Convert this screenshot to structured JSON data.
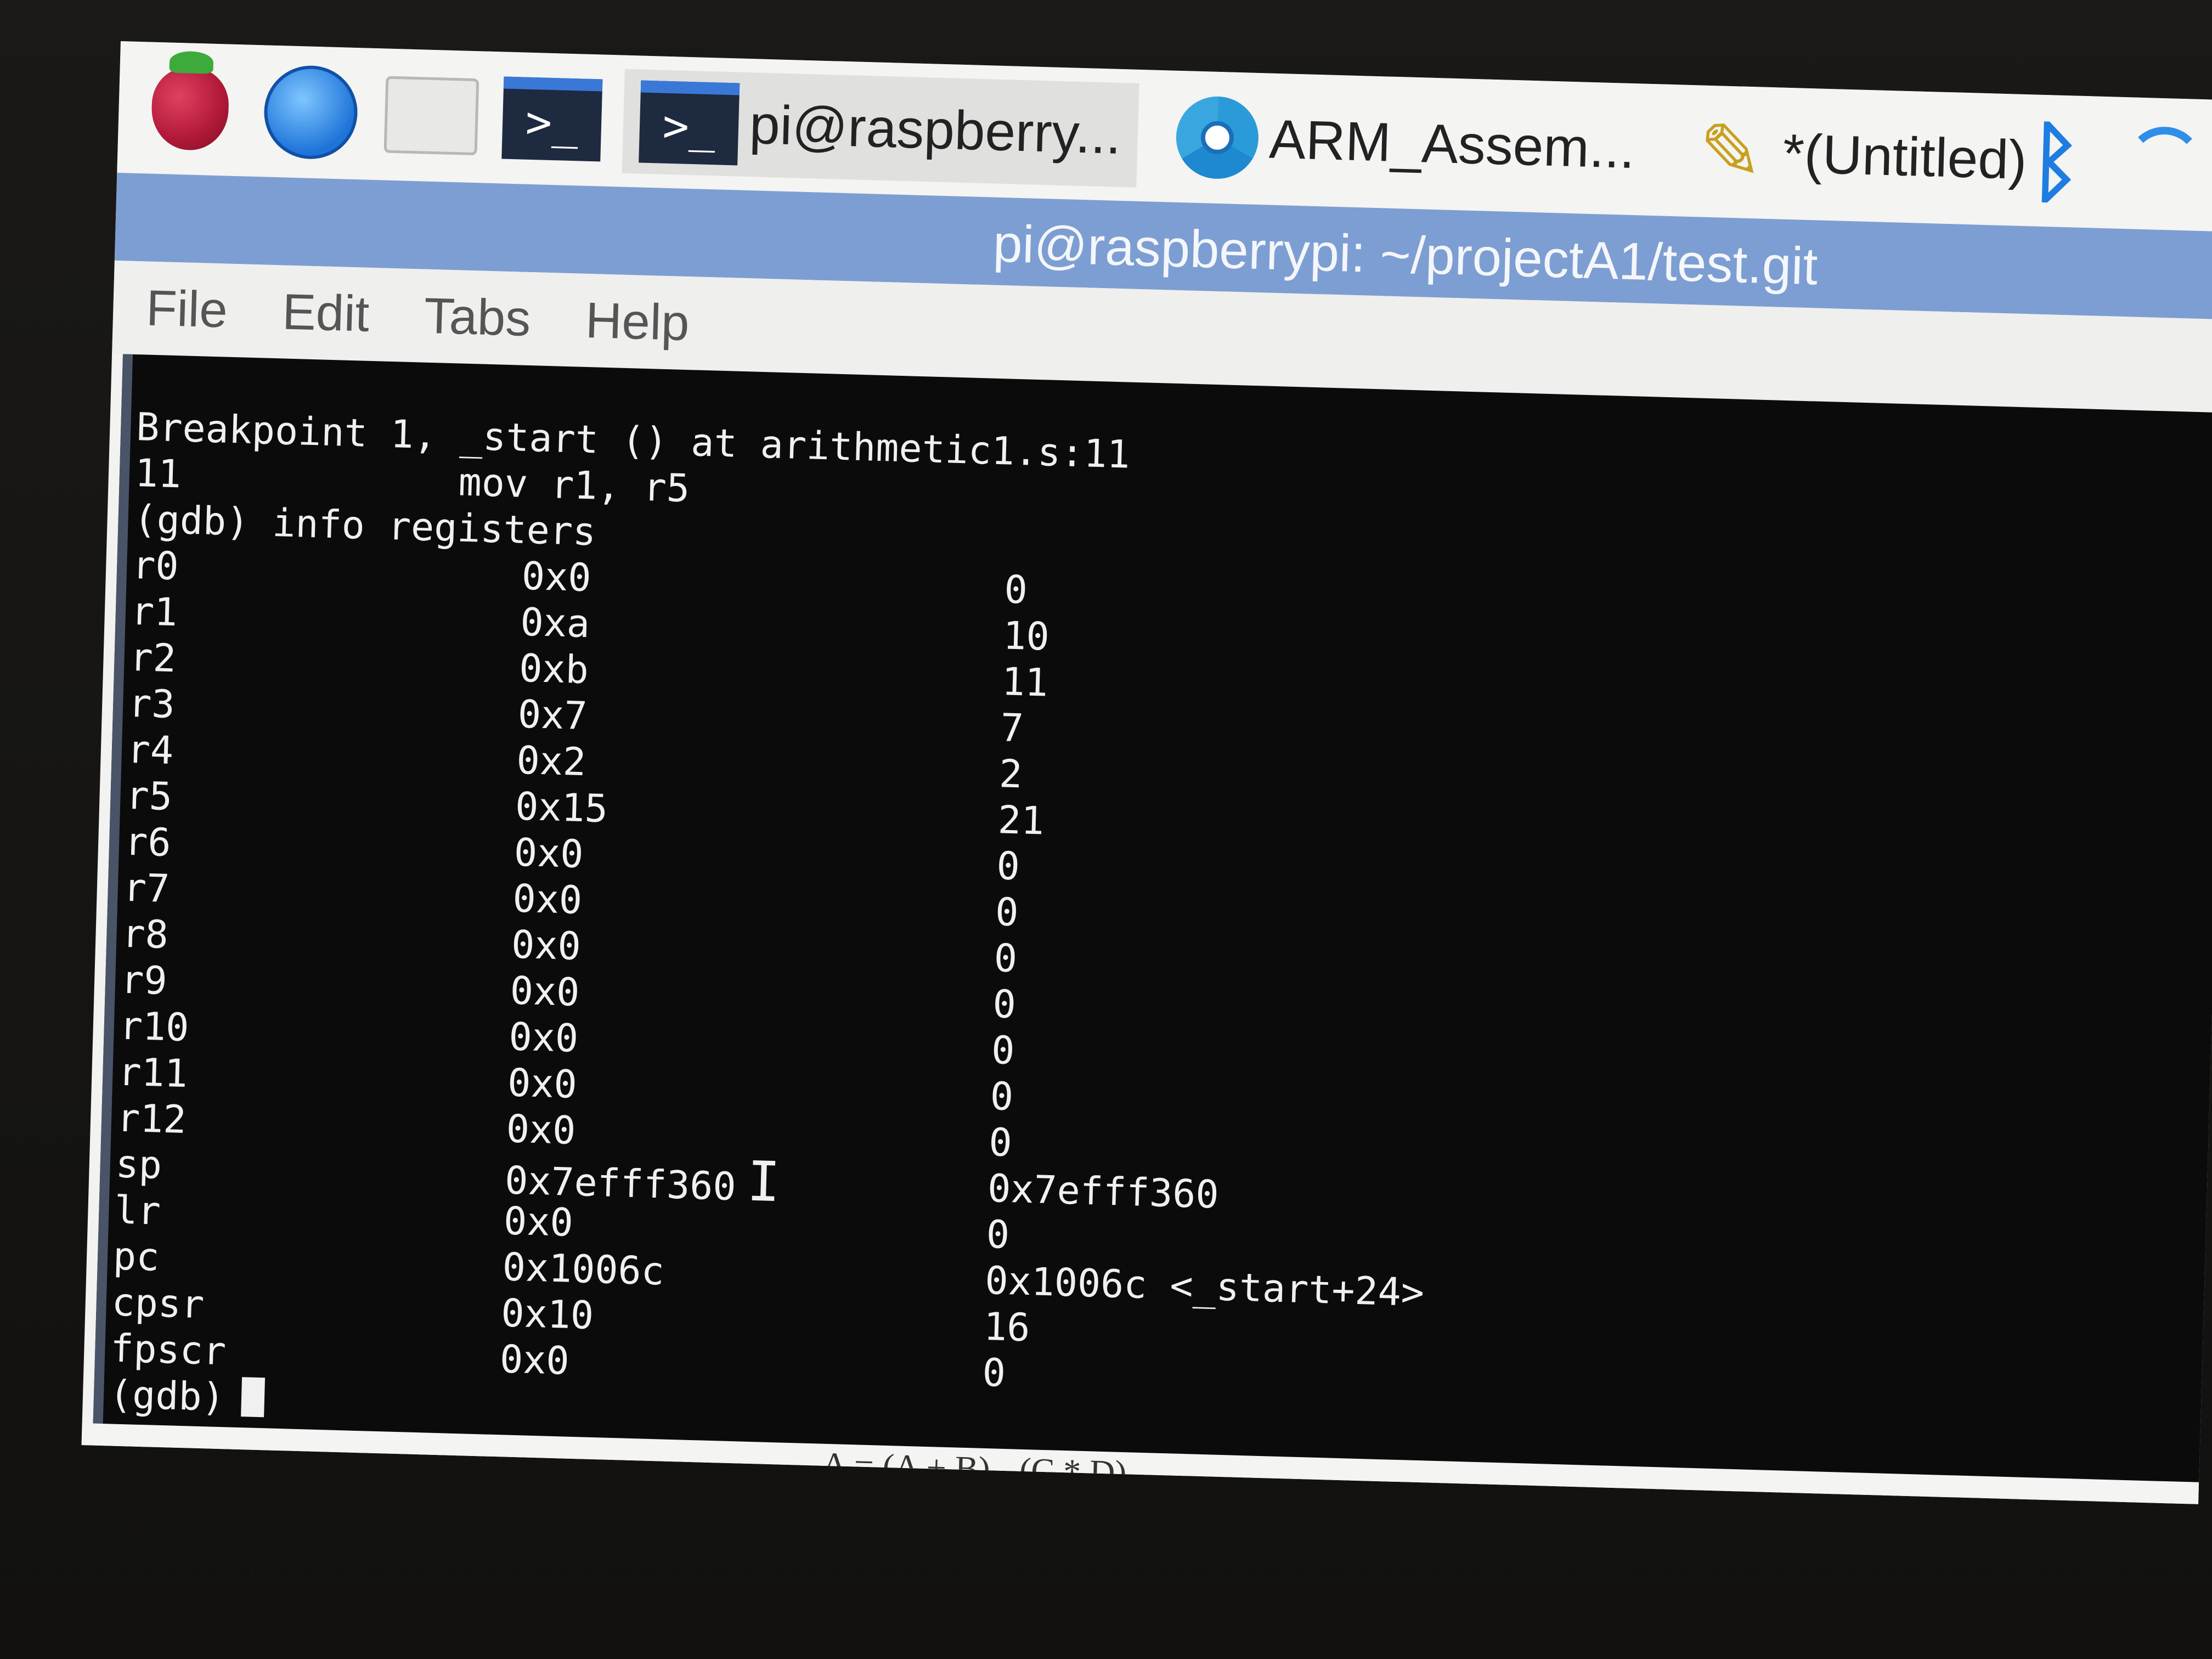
{
  "taskbar": {
    "launchers": [
      {
        "name": "raspberry-menu-icon"
      },
      {
        "name": "web-browser-icon"
      },
      {
        "name": "file-manager-icon"
      },
      {
        "name": "terminal-icon"
      }
    ],
    "tasks": [
      {
        "label": "pi@raspberry...",
        "icon": "terminal-icon"
      },
      {
        "label": "ARM_Assem...",
        "icon": "chromium-icon"
      },
      {
        "label": "*(Untitled)",
        "icon": "text-editor-icon"
      }
    ],
    "tray": {
      "bluetooth": "bluetooth-icon",
      "wifi": "wifi-icon"
    }
  },
  "window": {
    "title": "pi@raspberrypi: ~/projectA1/test.git",
    "menu": [
      "File",
      "Edit",
      "Tabs",
      "Help"
    ]
  },
  "terminal": {
    "lines": [
      "Breakpoint 1, _start () at arithmetic1.s:11",
      "11            mov r1, r5",
      "(gdb) info registers"
    ],
    "registers": [
      {
        "name": "r0",
        "hex": "0x0",
        "value": "0"
      },
      {
        "name": "r1",
        "hex": "0xa",
        "value": "10"
      },
      {
        "name": "r2",
        "hex": "0xb",
        "value": "11"
      },
      {
        "name": "r3",
        "hex": "0x7",
        "value": "7"
      },
      {
        "name": "r4",
        "hex": "0x2",
        "value": "2"
      },
      {
        "name": "r5",
        "hex": "0x15",
        "value": "21"
      },
      {
        "name": "r6",
        "hex": "0x0",
        "value": "0"
      },
      {
        "name": "r7",
        "hex": "0x0",
        "value": "0"
      },
      {
        "name": "r8",
        "hex": "0x0",
        "value": "0"
      },
      {
        "name": "r9",
        "hex": "0x0",
        "value": "0"
      },
      {
        "name": "r10",
        "hex": "0x0",
        "value": "0"
      },
      {
        "name": "r11",
        "hex": "0x0",
        "value": "0"
      },
      {
        "name": "r12",
        "hex": "0x0",
        "value": "0"
      },
      {
        "name": "sp",
        "hex": "0x7efff360",
        "value": "0x7efff360"
      },
      {
        "name": "lr",
        "hex": "0x0",
        "value": "0"
      },
      {
        "name": "pc",
        "hex": "0x1006c",
        "value": "0x1006c <_start+24>"
      },
      {
        "name": "cpsr",
        "hex": "0x10",
        "value": "16"
      },
      {
        "name": "fpscr",
        "hex": "0x0",
        "value": "0"
      }
    ],
    "prompt": "(gdb)"
  },
  "background_window": {
    "partial_text": "A = (A + B) - (C * D)"
  },
  "colors": {
    "titlebar": "#7d9ed2",
    "terminal_bg": "#0b0b0b",
    "terminal_fg": "#f0f0f0"
  }
}
